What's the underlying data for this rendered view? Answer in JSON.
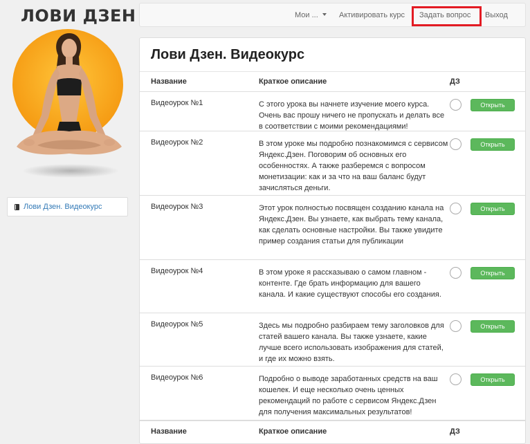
{
  "brand": {
    "logo_text": "ЛОВИ ДЗЕН"
  },
  "colors": {
    "accent_green": "#5cb85c",
    "highlight_red": "#e31b23",
    "link_blue": "#337ab7",
    "hero_sun": "#f7a418"
  },
  "sidebar": {
    "items": [
      {
        "label": "Лови Дзен. Видеокурс",
        "icon": "book-icon"
      }
    ]
  },
  "navbar": {
    "my_label": "Мои ...",
    "activate_label": "Активировать курс",
    "ask_label": "Задать вопрос",
    "logout_label": "Выход"
  },
  "panel": {
    "title": "Лови Дзен. Видеокурс"
  },
  "table": {
    "headers": {
      "name": "Название",
      "desc": "Краткое описание",
      "hw": "ДЗ"
    },
    "open_label": "Открыть",
    "rows": [
      {
        "name": "Видеоурок №1",
        "desc": "С этого урока вы начнете изучение моего курса. Очень вас прошу ничего не пропускать и делать все в соответствии с моими рекомендациями!"
      },
      {
        "name": "Видеоурок №2",
        "desc": "В этом уроке мы подробно познакомимся с сервисом Яндекс.Дзен. Поговорим об основных его особенностях. А также разберемся с вопросом монетизации: как и за что на ваш баланс будут зачисляться деньги."
      },
      {
        "name": "Видеоурок №3",
        "desc": "Этот урок полностью посвящен созданию канала на Яндекс.Дзен. Вы узнаете, как выбрать тему канала, как сделать основные настройки. Вы также увидите пример создания статьи для публикации"
      },
      {
        "name": "Видеоурок №4",
        "desc": "В этом уроке я рассказываю о самом главном - контенте. Где брать информацию для вашего канала. И какие существуют способы его создания."
      },
      {
        "name": "Видеоурок №5",
        "desc": "Здесь мы подробно разбираем тему заголовков для статей вашего канала. Вы также узнаете, какие лучше всего использовать изображения для статей, и где их можно взять."
      },
      {
        "name": "Видеоурок №6",
        "desc": "Подробно о выводе заработанных средств на ваш кошелек. И еще несколько очень ценных рекомендаций по работе с сервисом Яндекс.Дзен для получения максимальных результатов!"
      }
    ]
  }
}
